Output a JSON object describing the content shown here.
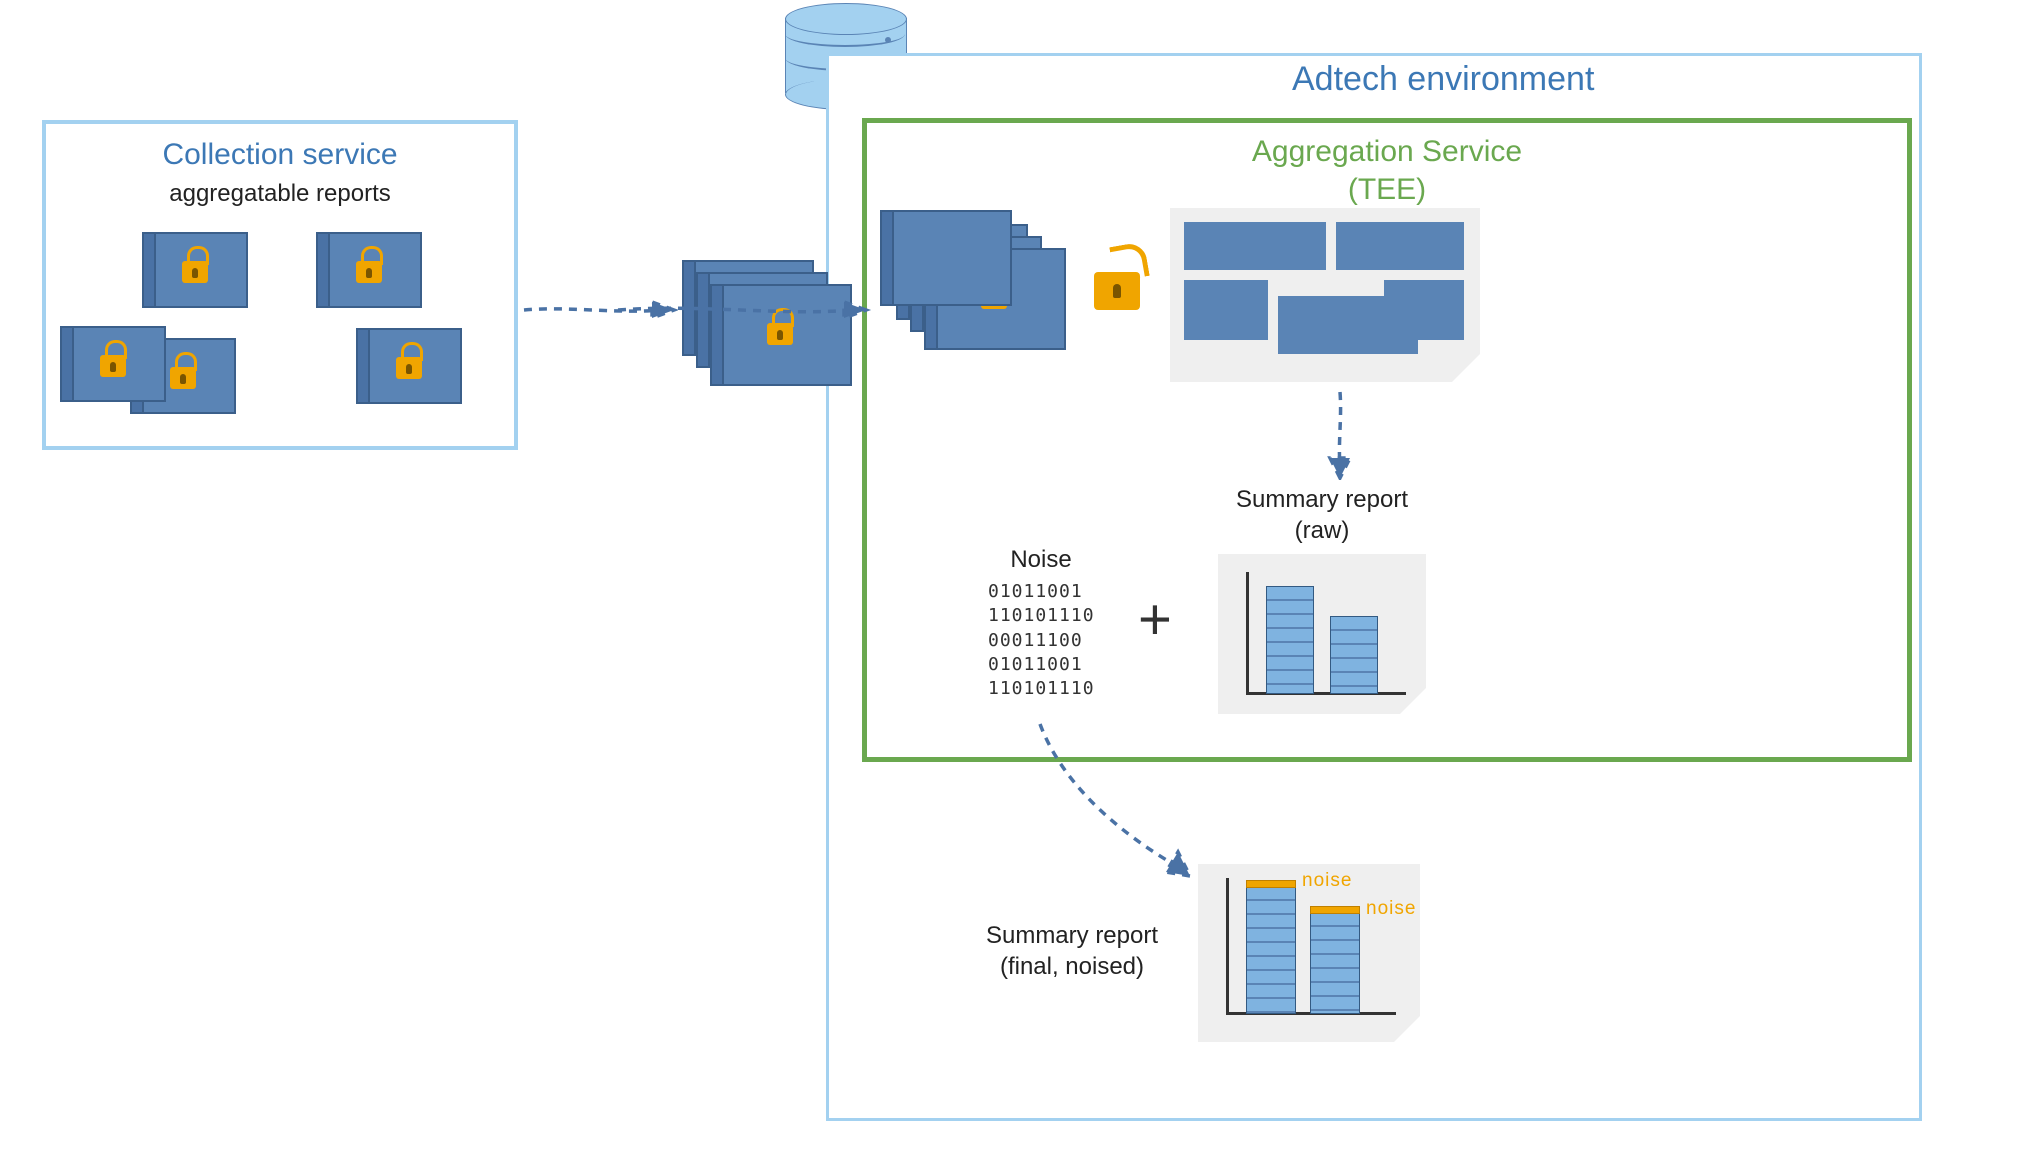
{
  "collection": {
    "title": "Collection service",
    "subtitle": "aggregatable reports"
  },
  "adtech": {
    "title": "Adtech environment"
  },
  "aggregation": {
    "title_line1": "Aggregation Service",
    "title_line2": "(TEE)"
  },
  "noise": {
    "title": "Noise",
    "lines": [
      "01011001",
      "110101110",
      "00011100",
      "01011001",
      "110101110"
    ]
  },
  "summary_raw": {
    "title_line1": "Summary report",
    "title_line2": "(raw)"
  },
  "summary_final": {
    "title_line1": "Summary report",
    "title_line2": "(final, noised)",
    "noise_label": "noise"
  },
  "plus_symbol": "+",
  "icons": {
    "locked_card": "lock-icon",
    "open_lock": "open-lock-icon",
    "database": "database-icon"
  },
  "colors": {
    "box_blue": "#a3d1f0",
    "box_green": "#6aa84f",
    "card_blue": "#5a84b5",
    "heading_blue": "#3c78b5",
    "lock_orange": "#f0a500"
  }
}
